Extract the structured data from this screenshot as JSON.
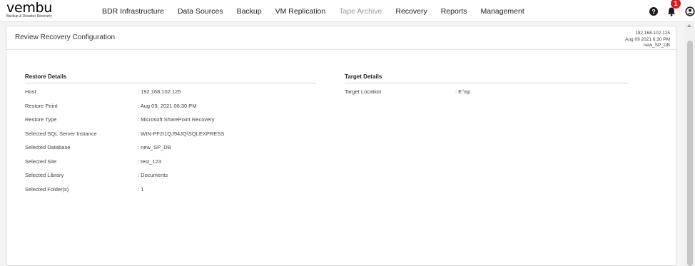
{
  "brand": {
    "name": "vembu",
    "tagline": "Backup & Disaster Recovery"
  },
  "nav": [
    {
      "label": "BDR Infrastructure",
      "dim": false
    },
    {
      "label": "Data Sources",
      "dim": false
    },
    {
      "label": "Backup",
      "dim": false
    },
    {
      "label": "VM Replication",
      "dim": false
    },
    {
      "label": "Tape Archive",
      "dim": true
    },
    {
      "label": "Recovery",
      "dim": false
    },
    {
      "label": "Reports",
      "dim": false
    },
    {
      "label": "Management",
      "dim": false
    }
  ],
  "notifications": {
    "count": "1"
  },
  "page": {
    "title": "Review Recovery Configuration",
    "info": {
      "host": "192.168.102.125",
      "date": "Aug 09 2021 6:30 PM",
      "name": "new_SP_DB"
    }
  },
  "restore": {
    "title": "Restore Details",
    "rows": [
      {
        "label": "Host",
        "value": ": 192.168.102.125"
      },
      {
        "label": "Restore Point",
        "value": ": Aug 09, 2021 06:30 PM"
      },
      {
        "label": "Restore Type",
        "value": ": Microsoft SharePoint Recovery"
      },
      {
        "label": "Selected SQL Server Instance",
        "value": ": WIN-PF2I1QJ94JQ\\SQLEXPRESS"
      },
      {
        "label": "Selected Database",
        "value": ": new_SP_DB"
      },
      {
        "label": "Selected Site",
        "value": ": test_123"
      },
      {
        "label": "Selected Library",
        "value": ": Documents"
      },
      {
        "label": "Selected Folder(s)",
        "value": ": 1"
      }
    ]
  },
  "target": {
    "title": "Target Details",
    "rows": [
      {
        "label": "Target Location",
        "value": ": E:\\sp"
      }
    ]
  }
}
